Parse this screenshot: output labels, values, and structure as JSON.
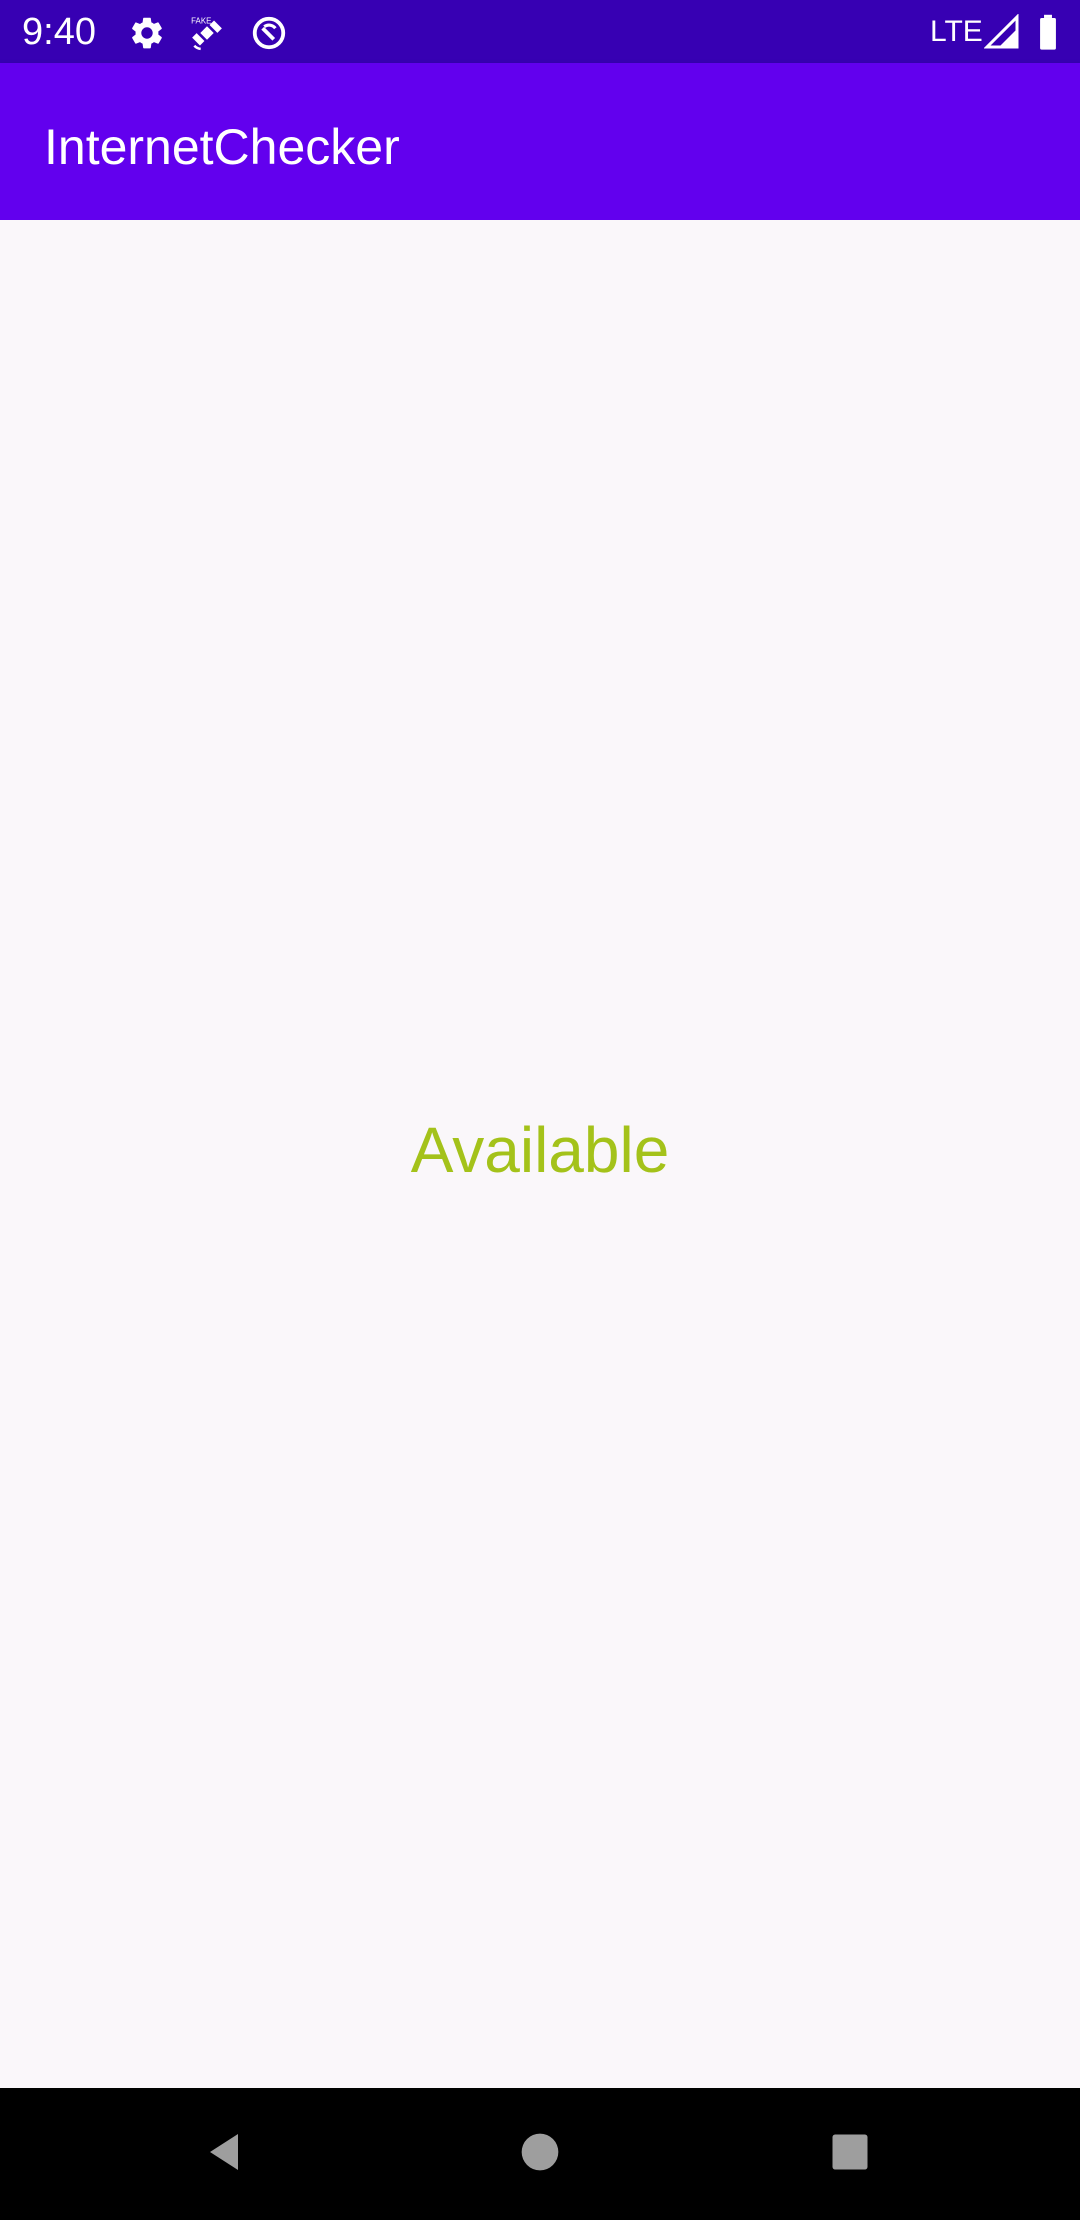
{
  "status_bar": {
    "time": "9:40",
    "icons": [
      "gear-icon",
      "satellite-icon",
      "sync-icon"
    ],
    "network_type": "LTE",
    "signal_icon": "signal-icon",
    "battery_icon": "battery-icon"
  },
  "app_bar": {
    "title": "InternetChecker"
  },
  "main": {
    "connection_status": "Available",
    "connection_status_color": "#a4c21a"
  },
  "nav_bar": {
    "buttons": [
      "back-icon",
      "home-icon",
      "recents-icon"
    ]
  },
  "colors": {
    "status_bar": "#3700b3",
    "app_bar": "#6200ee",
    "background": "#faf7fa",
    "nav_bar": "#000000"
  }
}
